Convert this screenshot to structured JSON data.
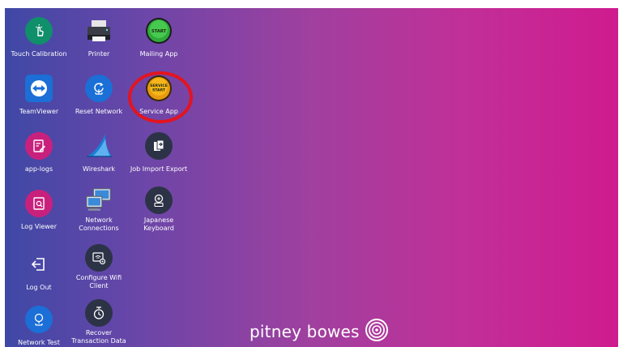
{
  "desktop": {
    "icons": [
      {
        "label": "Touch Calibration",
        "icon": "hand-touch-icon"
      },
      {
        "label": "Printer",
        "icon": "printer-icon"
      },
      {
        "label": "Mailing App",
        "icon": "start-button-icon",
        "badge": "START"
      },
      {
        "label": "TeamViewer",
        "icon": "teamviewer-icon"
      },
      {
        "label": "Reset Network",
        "icon": "network-reset-icon"
      },
      {
        "label": "Service App",
        "icon": "service-start-icon",
        "badge_line1": "SERVICE",
        "badge_line2": "START"
      },
      {
        "label": "app-logs",
        "icon": "app-logs-icon"
      },
      {
        "label": "Wireshark",
        "icon": "wireshark-fin-icon"
      },
      {
        "label": "Job Import Export",
        "icon": "import-export-icon"
      },
      {
        "label": "Log Viewer",
        "icon": "log-viewer-icon"
      },
      {
        "label_line1": "Network",
        "label_line2": "Connections",
        "icon": "network-computers-icon"
      },
      {
        "label_line1": "Japanese",
        "label_line2": "Keyboard",
        "icon": "japanese-keyboard-icon"
      },
      {
        "label": "Log Out",
        "icon": "logout-icon"
      },
      {
        "label_line1": "Configure Wifi",
        "label_line2": "Client",
        "icon": "wifi-config-icon"
      },
      {
        "label": "Network Test",
        "icon": "network-test-icon"
      },
      {
        "label_line1": "Recover",
        "label_line2": "Transaction Data",
        "icon": "recover-data-icon"
      }
    ]
  },
  "brand": {
    "text": "pitney bowes",
    "logo": "pitney-bowes-logo-icon"
  },
  "colors": {
    "gradient_start": "#3f48a6",
    "gradient_end": "#cf1b8e",
    "highlight": "#e3141f",
    "teal": "#0f8f6a",
    "blue": "#1b6fd6",
    "pink": "#c8217d",
    "dark": "#2c3346"
  }
}
